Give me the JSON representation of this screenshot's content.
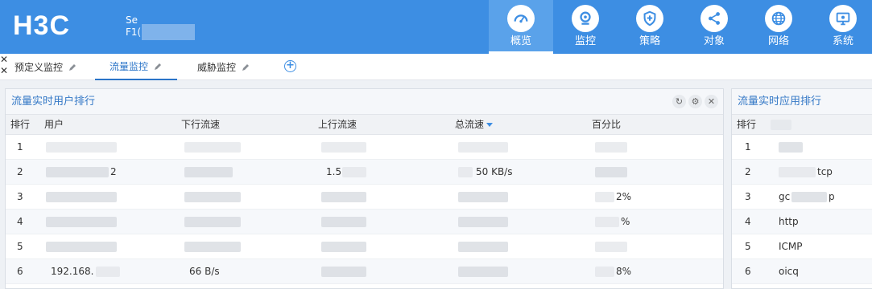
{
  "header": {
    "logo": "H3C",
    "device_line1": "Se",
    "device_line2": "F1(",
    "nav": [
      {
        "label": "概览",
        "icon": "gauge-icon",
        "active": true
      },
      {
        "label": "监控",
        "icon": "camera-icon",
        "active": false
      },
      {
        "label": "策略",
        "icon": "shield-plus-icon",
        "active": false
      },
      {
        "label": "对象",
        "icon": "share-nodes-icon",
        "active": false
      },
      {
        "label": "网络",
        "icon": "globe-icon",
        "active": false
      },
      {
        "label": "系统",
        "icon": "monitor-gear-icon",
        "active": false
      }
    ]
  },
  "tabs": [
    {
      "label": "预定义监控",
      "active": false
    },
    {
      "label": "流量监控",
      "active": true
    },
    {
      "label": "威胁监控",
      "active": false
    }
  ],
  "left_panel": {
    "title": "流量实时用户排行",
    "columns": [
      "排行",
      "用户",
      "下行流速",
      "上行流速",
      "总流速",
      "百分比"
    ],
    "rows": [
      {
        "rank": "1",
        "user": "",
        "down": "",
        "up": "",
        "total": "",
        "percent": ""
      },
      {
        "rank": "2",
        "user": "2",
        "down": "",
        "up": "1.5",
        "total": "50 KB/s",
        "percent": ""
      },
      {
        "rank": "3",
        "user": "",
        "down": "",
        "up": "",
        "total": "",
        "percent": "2%"
      },
      {
        "rank": "4",
        "user": "",
        "down": "",
        "up": "",
        "total": "",
        "percent": "%"
      },
      {
        "rank": "5",
        "user": "",
        "down": "",
        "up": "",
        "total": "",
        "percent": ""
      },
      {
        "rank": "6",
        "user": "192.168.",
        "down": "66 B/s",
        "up": "",
        "total": "",
        "percent": "8%"
      }
    ]
  },
  "right_panel": {
    "title": "流量实时应用排行",
    "columns": [
      "排行"
    ],
    "rows": [
      {
        "rank": "1",
        "app": ""
      },
      {
        "rank": "2",
        "app": "tcp"
      },
      {
        "rank": "3",
        "app": "gc",
        "app_suffix": "p"
      },
      {
        "rank": "4",
        "app": "http"
      },
      {
        "rank": "5",
        "app": "ICMP"
      },
      {
        "rank": "6",
        "app": "oicq"
      }
    ]
  },
  "colors": {
    "header_bg": "#3d8ee3",
    "accent": "#2a74c8"
  }
}
